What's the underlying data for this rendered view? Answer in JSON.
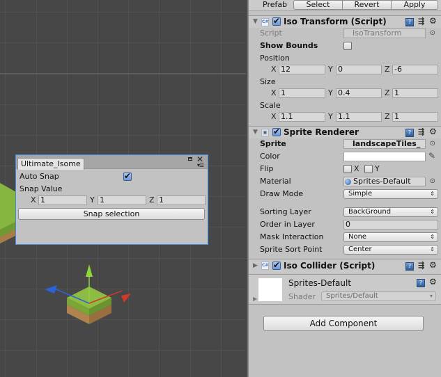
{
  "scene": {
    "tool_window": {
      "tab_title": "Ultimate_Isome",
      "auto_snap_label": "Auto Snap",
      "auto_snap_checked": true,
      "snap_value_label": "Snap Value",
      "axes": [
        "X",
        "Y",
        "Z"
      ],
      "snap_values": [
        "1",
        "1",
        "1"
      ],
      "snap_button": "Snap selection"
    },
    "gizmo_colors": {
      "x": "#d0392a",
      "y": "#8ed63a",
      "z": "#2c63d8"
    },
    "tile_colors": {
      "grass": "#8dbb43",
      "dirt": "#b0834f"
    }
  },
  "inspector": {
    "prefab": {
      "label": "Prefab",
      "buttons": [
        "Select",
        "Revert",
        "Apply"
      ]
    },
    "iso_transform": {
      "title": "Iso Transform (Script)",
      "enabled": true,
      "script_label": "Script",
      "script_value": "IsoTransform",
      "show_bounds_label": "Show Bounds",
      "show_bounds_checked": false,
      "position_label": "Position",
      "position": [
        "12",
        "0",
        "-6"
      ],
      "size_label": "Size",
      "size": [
        "1",
        "0.4",
        "1"
      ],
      "scale_label": "Scale",
      "scale": [
        "1.1",
        "1.1",
        "1"
      ],
      "axes": [
        "X",
        "Y",
        "Z"
      ]
    },
    "sprite_renderer": {
      "title": "Sprite Renderer",
      "enabled": true,
      "sprite_label": "Sprite",
      "sprite_value": "landscapeTiles_",
      "color_label": "Color",
      "color_value": "#ffffff",
      "flip_label": "Flip",
      "flip_x": "X",
      "flip_y": "Y",
      "material_label": "Material",
      "material_value": "Sprites-Default",
      "draw_mode_label": "Draw Mode",
      "draw_mode_value": "Simple",
      "sorting_layer_label": "Sorting Layer",
      "sorting_layer_value": "BackGround",
      "order_label": "Order in Layer",
      "order_value": "0",
      "mask_label": "Mask Interaction",
      "mask_value": "None",
      "sort_point_label": "Sprite Sort Point",
      "sort_point_value": "Center"
    },
    "iso_collider": {
      "title": "Iso Collider (Script)",
      "enabled": true
    },
    "material": {
      "name": "Sprites-Default",
      "shader_label": "Shader",
      "shader_value": "Sprites/Default"
    },
    "add_component": "Add Component"
  }
}
